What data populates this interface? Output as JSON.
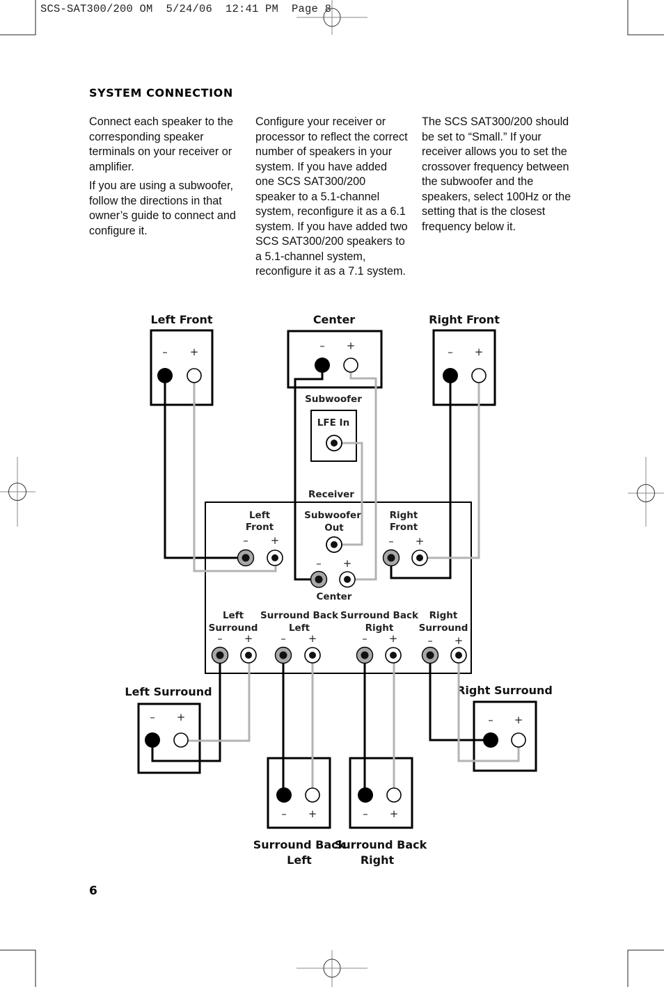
{
  "print_slug": "SCS-SAT300/200 OM  5/24/06  12:41 PM  Page 8",
  "section_heading": "SYSTEM CONNECTION",
  "columns": [
    {
      "paragraphs": [
        "Connect each speaker to the corresponding speaker terminals on your receiver or amplifier.",
        "If you are using a subwoofer, follow the directions in that owner’s guide to connect and configure it."
      ]
    },
    {
      "paragraphs": [
        "Configure your receiver or processor to reflect the correct number of speakers in your system. If you have added one SCS SAT300/200 speaker to a 5.1-channel system, reconfigure it as a 6.1 system. If you have added two SCS SAT300/200 speakers to a 5.1-channel system, reconfigure it as a 7.1 system."
      ]
    },
    {
      "paragraphs": [
        "The SCS SAT300/200 should be set to “Small.” If your receiver allows you to set the crossover frequency between the subwoofer and the speakers, select 100Hz or the setting that is the closest frequency below it."
      ]
    }
  ],
  "diagram": {
    "speakers": {
      "left_front": "Left Front",
      "center": "Center",
      "right_front": "Right Front",
      "left_surround": "Left Surround",
      "right_surround": "Right Surround",
      "surround_back_left": [
        "Surround Back",
        "Left"
      ],
      "surround_back_right": [
        "Surround Back",
        "Right"
      ]
    },
    "subwoofer": {
      "title": "Subwoofer",
      "input_label": "LFE In"
    },
    "receiver": {
      "title": "Receiver",
      "left_front": [
        "Left",
        "Front"
      ],
      "subwoofer_out": [
        "Subwoofer",
        "Out"
      ],
      "right_front": [
        "Right",
        "Front"
      ],
      "center": "Center",
      "left_surround": [
        "Left",
        "Surround"
      ],
      "surround_back_left": [
        "Surround Back",
        "Left"
      ],
      "surround_back_right": [
        "Surround Back",
        "Right"
      ],
      "right_surround": [
        "Right",
        "Surround"
      ]
    },
    "polarity": {
      "negative": "–",
      "positive": "+"
    },
    "colors": {
      "negative_wire": "#000000",
      "positive_wire": "#b3b3b3",
      "receiver_negative_terminal": "#a8a8a8"
    }
  },
  "page_number": "6"
}
